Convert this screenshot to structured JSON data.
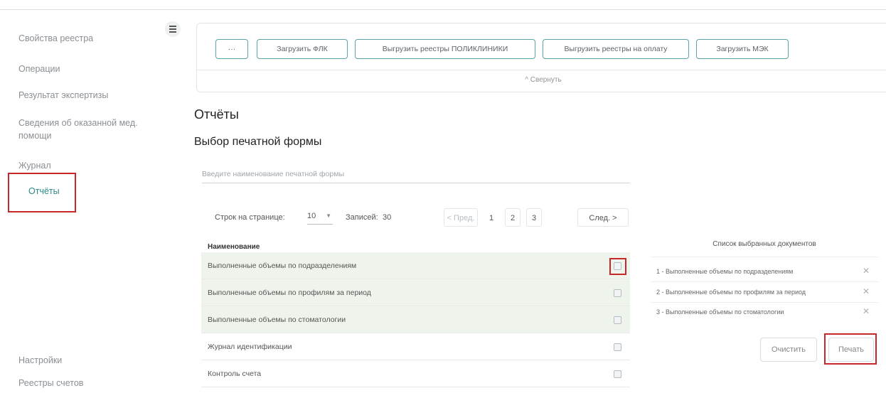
{
  "sidebar": {
    "items": [
      {
        "label": "Свойства реестра"
      },
      {
        "label": "Операции"
      },
      {
        "label": "Результат экспертизы"
      },
      {
        "label": "Сведения об оказанной мед. помощи"
      },
      {
        "label": "Журнал"
      },
      {
        "label": "Отчёты",
        "active": true
      }
    ],
    "bottom_items": [
      {
        "label": "Настройки"
      },
      {
        "label": "Реестры счетов"
      }
    ]
  },
  "toolbar": {
    "more_label": "···",
    "buttons": [
      {
        "label": "Загрузить ФЛК"
      },
      {
        "label": "Выгрузить реестры ПОЛИКЛИНИКИ"
      },
      {
        "label": "Выгрузить реестры на оплату"
      },
      {
        "label": "Загрузить МЭК"
      }
    ],
    "collapse_label": "^ Свернуть"
  },
  "page": {
    "title": "Отчёты",
    "subtitle": "Выбор печатной формы",
    "search_placeholder": "Введите наименование печатной формы"
  },
  "pagination": {
    "rows_per_page_label": "Строк на странице:",
    "rows_per_page_value": "10",
    "records_label": "Записей:",
    "records_value": "30",
    "prev_label": "< Пред.",
    "pages": [
      "1",
      "2",
      "3"
    ],
    "next_label": "След. >"
  },
  "table": {
    "header": "Наименование",
    "rows": [
      {
        "name": "Выполненные объемы по подразделениям",
        "selected": true
      },
      {
        "name": "Выполненные объемы по профилям за период",
        "selected": true
      },
      {
        "name": "Выполненные объемы по стоматологии",
        "selected": true
      },
      {
        "name": "Журнал идентификации",
        "selected": false
      },
      {
        "name": "Контроль счета",
        "selected": false
      }
    ]
  },
  "selected_docs": {
    "title": "Список выбранных документов",
    "items": [
      "1 - Выполненные объемы по подразделениям",
      "2 - Выполненные объемы по профилям за период",
      "3 - Выполненные объемы по стоматологии"
    ],
    "remove_symbol": "✕",
    "clear_label": "Очистить",
    "print_label": "Печать"
  },
  "colors": {
    "accent": "#2a8a8a",
    "highlight": "#c62828",
    "selected_row": "#eef3ec"
  }
}
